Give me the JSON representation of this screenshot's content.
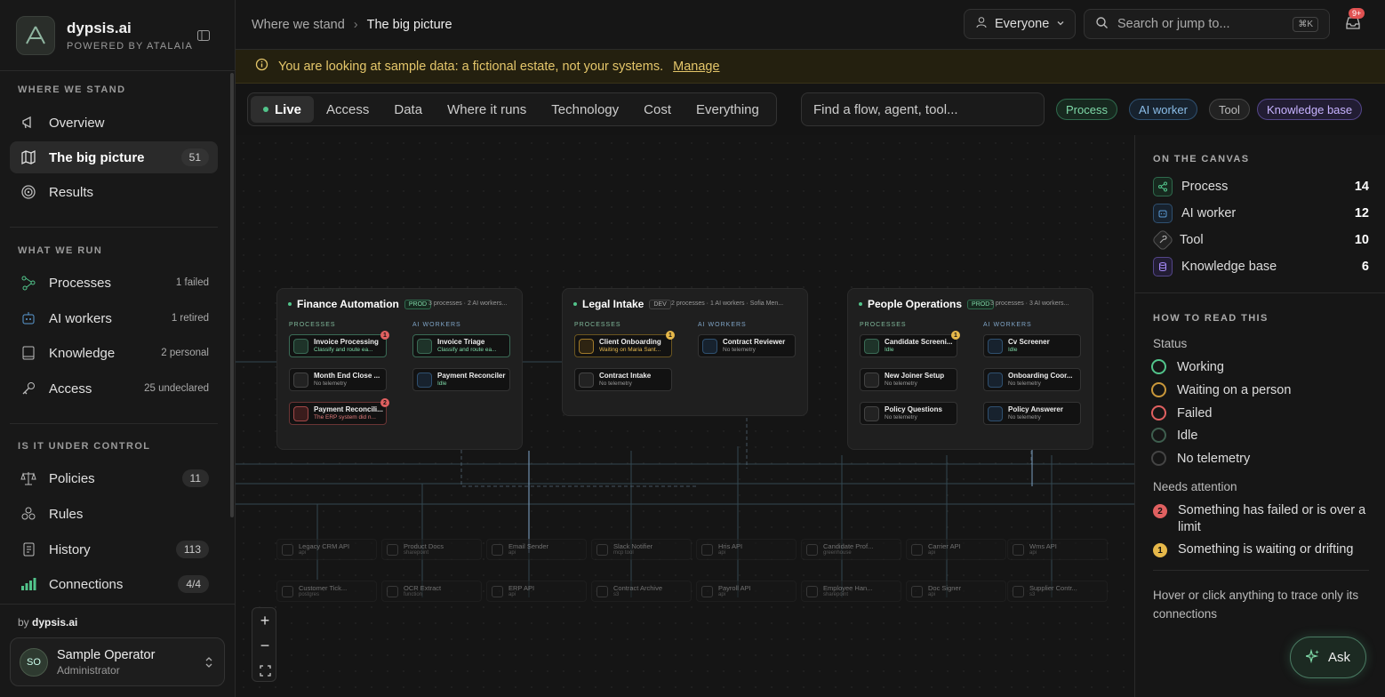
{
  "brand": {
    "name": "dypsis.ai",
    "sub": "POWERED BY ATALAIA"
  },
  "sidebar": {
    "sections": [
      {
        "title": "WHERE WE STAND"
      },
      {
        "title": "WHAT WE RUN"
      },
      {
        "title": "IS IT UNDER CONTROL"
      }
    ],
    "items": [
      {
        "label": "Overview",
        "icon": "megaphone-icon"
      },
      {
        "label": "The big picture",
        "icon": "map-icon",
        "count": "51"
      },
      {
        "label": "Results",
        "icon": "target-icon"
      },
      {
        "label": "Processes",
        "icon": "flow-icon",
        "meta": "1 failed"
      },
      {
        "label": "AI workers",
        "icon": "robot-icon",
        "meta": "1 retired"
      },
      {
        "label": "Knowledge",
        "icon": "book-icon",
        "meta": "2 personal"
      },
      {
        "label": "Access",
        "icon": "key-icon",
        "meta": "25 undeclared"
      },
      {
        "label": "Policies",
        "icon": "scale-icon",
        "count": "11"
      },
      {
        "label": "Rules",
        "icon": "cubes-icon"
      },
      {
        "label": "History",
        "icon": "scroll-icon",
        "count": "113"
      },
      {
        "label": "Connections",
        "icon": "signal-icon",
        "count": "4/4"
      }
    ],
    "by_prefix": "by",
    "by_brand": "dypsis.ai",
    "user": {
      "initials": "SO",
      "name": "Sample Operator",
      "role": "Administrator"
    }
  },
  "topbar": {
    "breadcrumb": [
      "Where we stand",
      "The big picture"
    ],
    "audience": "Everyone",
    "search_placeholder": "Search or jump to...",
    "shortcut": "⌘K",
    "inbox_badge": "9+"
  },
  "banner": {
    "text": "You are looking at sample data: a fictional estate, not your systems.",
    "link": "Manage"
  },
  "views": {
    "tabs": [
      "Live",
      "Access",
      "Data",
      "Where it runs",
      "Technology",
      "Cost",
      "Everything"
    ],
    "find_placeholder": "Find a flow, agent, tool...",
    "chips": [
      {
        "label": "Process",
        "color": "#52c48b"
      },
      {
        "label": "AI worker",
        "color": "#5b9bd5"
      },
      {
        "label": "Tool",
        "color": "#9a9a9a"
      },
      {
        "label": "Knowledge base",
        "color": "#a78bfa"
      }
    ]
  },
  "canvas": {
    "col_proc": "PROCESSES",
    "col_ai": "AI WORKERS",
    "groups": [
      {
        "title": "Finance Automation",
        "env": "PROD",
        "meta": "3 processes · 2 AI workers...",
        "processes": [
          {
            "title": "Invoice Processing",
            "sub": "Classify and route ea...",
            "status": "working",
            "badge": "1",
            "badge_color": "#e06060"
          },
          {
            "title": "Month End Close ...",
            "sub": "No telemetry",
            "status": "none"
          },
          {
            "title": "Payment Reconcili...",
            "sub": "The ERP system did n...",
            "status": "failed",
            "badge": "2",
            "badge_color": "#e06060"
          }
        ],
        "workers": [
          {
            "title": "Invoice Triage",
            "sub": "Classify and route ea...",
            "status": "working"
          },
          {
            "title": "Payment Reconciler",
            "sub": "Idle",
            "status": "idle"
          }
        ]
      },
      {
        "title": "Legal Intake",
        "env": "DEV",
        "meta": "2 processes · 1 AI workers · Sofia Men...",
        "processes": [
          {
            "title": "Client Onboarding",
            "sub": "Waiting on Maria Sant...",
            "status": "waiting",
            "badge": "1",
            "badge_color": "#e6b84a"
          },
          {
            "title": "Contract Intake",
            "sub": "No telemetry",
            "status": "none"
          }
        ],
        "workers": [
          {
            "title": "Contract Reviewer",
            "sub": "No telemetry",
            "status": "none"
          }
        ]
      },
      {
        "title": "People Operations",
        "env": "PROD",
        "meta": "3 processes · 3 AI workers...",
        "processes": [
          {
            "title": "Candidate Screeni...",
            "sub": "Idle",
            "status": "idle",
            "badge": "1",
            "badge_color": "#e6b84a"
          },
          {
            "title": "New Joiner Setup",
            "sub": "No telemetry",
            "status": "none"
          },
          {
            "title": "Policy Questions",
            "sub": "No telemetry",
            "status": "none"
          }
        ],
        "workers": [
          {
            "title": "Cv Screener",
            "sub": "Idle",
            "status": "idle"
          },
          {
            "title": "Onboarding Coor...",
            "sub": "No telemetry",
            "status": "none"
          },
          {
            "title": "Policy Answerer",
            "sub": "No telemetry",
            "status": "none"
          }
        ]
      }
    ],
    "tools": [
      {
        "title": "Legacy CRM API",
        "sub": "api"
      },
      {
        "title": "Product Docs",
        "sub": "sharepoint"
      },
      {
        "title": "Email Sender",
        "sub": "api"
      },
      {
        "title": "Slack Notifier",
        "sub": "mcp tool"
      },
      {
        "title": "Hris API",
        "sub": "api"
      },
      {
        "title": "Candidate Prof...",
        "sub": "greenhouse"
      },
      {
        "title": "Carrier API",
        "sub": "api"
      },
      {
        "title": "Wms API",
        "sub": "api"
      },
      {
        "title": "Customer Tick...",
        "sub": "postgres"
      },
      {
        "title": "OCR Extract",
        "sub": "function"
      },
      {
        "title": "ERP API",
        "sub": "api"
      },
      {
        "title": "Contract Archive",
        "sub": "s3"
      },
      {
        "title": "Payroll API",
        "sub": "api"
      },
      {
        "title": "Employee Han...",
        "sub": "sharepoint"
      },
      {
        "title": "Doc Signer",
        "sub": "api"
      },
      {
        "title": "Supplier Contr...",
        "sub": "s3"
      }
    ]
  },
  "panel": {
    "canvas_title": "ON THE CANVAS",
    "legend": [
      {
        "label": "Process",
        "count": "14",
        "color": "#52c48b",
        "icon": "share-icon"
      },
      {
        "label": "AI worker",
        "count": "12",
        "color": "#5b9bd5",
        "icon": "robot-icon"
      },
      {
        "label": "Tool",
        "count": "10",
        "color": "#9a9a9a",
        "icon": "wrench-icon"
      },
      {
        "label": "Knowledge base",
        "count": "6",
        "color": "#a78bfa",
        "icon": "database-icon"
      }
    ],
    "read_title": "HOW TO READ THIS",
    "status_title": "Status",
    "statuses": [
      {
        "label": "Working",
        "color": "#52c48b"
      },
      {
        "label": "Waiting on a person",
        "color": "#c9973a"
      },
      {
        "label": "Failed",
        "color": "#e06060"
      },
      {
        "label": "Idle",
        "color": "#3e5e4e"
      },
      {
        "label": "No telemetry",
        "color": "#444444"
      }
    ],
    "attention_title": "Needs attention",
    "attention": [
      {
        "badge": "2",
        "label": "Something has failed or is over a limit",
        "color": "#e06060"
      },
      {
        "badge": "1",
        "label": "Something is waiting or drifting",
        "color": "#e6b84a"
      }
    ],
    "hint": "Hover or click anything to trace only its connections",
    "ask": "Ask"
  }
}
